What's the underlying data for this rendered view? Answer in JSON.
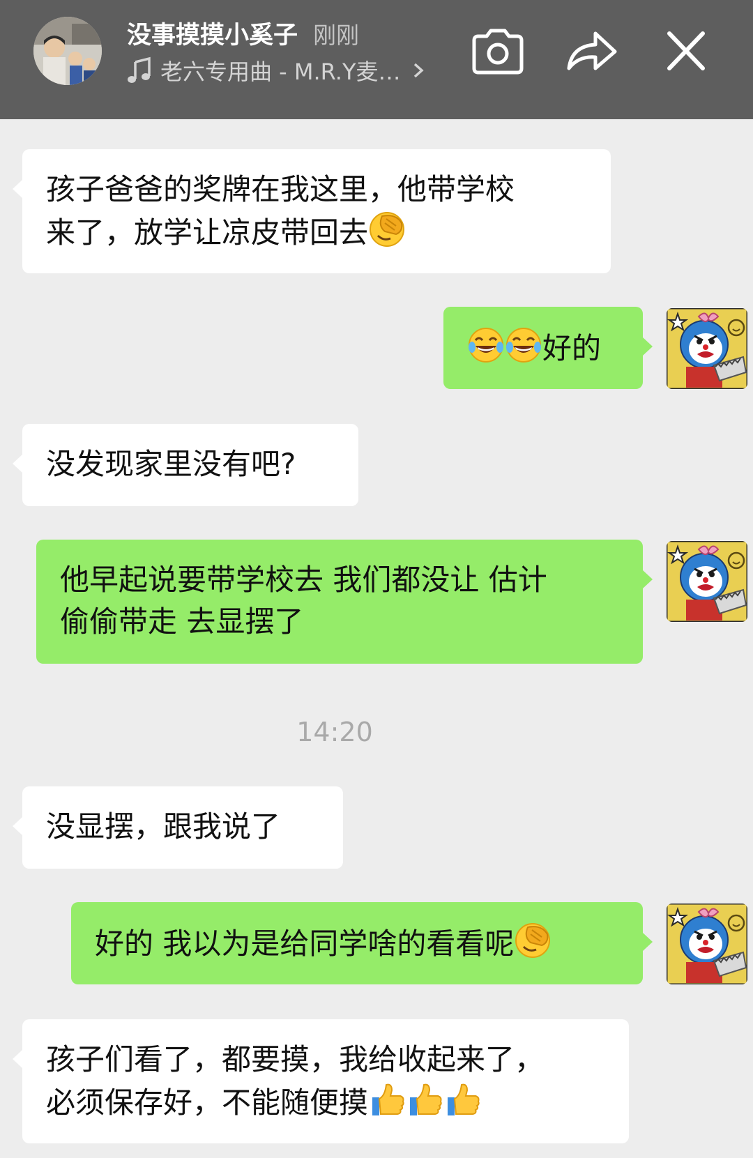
{
  "header": {
    "contact_name": "没事摸摸小奚子",
    "status": "刚刚",
    "music_icon": "music-note-icon",
    "music_title": "老六专用曲 - M.R.Y麦…",
    "buttons": [
      "camera-icon",
      "share-icon",
      "close-icon"
    ]
  },
  "messages": [
    {
      "side": "received",
      "lines": [
        "孩子爸爸的奖牌在我这里，他带学校",
        "来了，放学让凉皮带回去"
      ],
      "emoji_after": [
        "facepalm-emoji"
      ]
    },
    {
      "side": "sent",
      "lines": [
        "好的"
      ],
      "emoji_before": [
        "tears-of-joy-emoji",
        "tears-of-joy-emoji"
      ]
    },
    {
      "side": "received",
      "lines": [
        "没发现家里没有吧?"
      ]
    },
    {
      "side": "sent",
      "lines": [
        "他早起说要带学校去 我们都没让 估计",
        "偷偷带走 去显摆了"
      ]
    },
    {
      "side": "received",
      "lines": [
        "没显摆，跟我说了"
      ]
    },
    {
      "side": "sent",
      "lines": [
        "好的 我以为是给同学啥的看看呢"
      ],
      "emoji_after": [
        "facepalm-emoji"
      ]
    },
    {
      "side": "received",
      "lines": [
        "孩子们看了，都要摸，我给收起来了，",
        "必须保存好，不能随便摸"
      ],
      "emoji_after": [
        "thumbs-up-emoji",
        "thumbs-up-emoji",
        "thumbs-up-emoji"
      ]
    }
  ],
  "timestamp": "14:20",
  "colors": {
    "header_bg": "#5e5e5e",
    "chat_bg": "#ededed",
    "sent_bubble": "#95ec69",
    "received_bubble": "#ffffff"
  }
}
